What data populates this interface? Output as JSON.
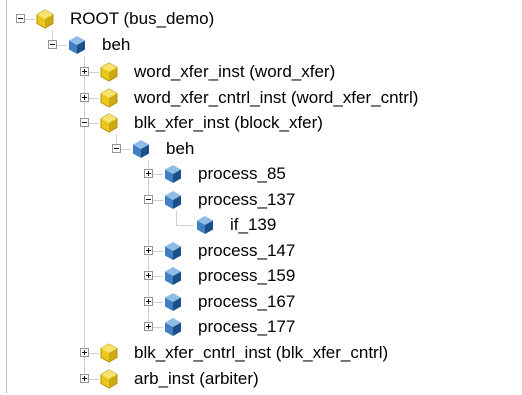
{
  "tree": {
    "nodes": [
      {
        "id": "root",
        "label": "ROOT (bus_demo)",
        "icon": "yellow-hexagon-icon",
        "state": "expanded"
      },
      {
        "id": "root-beh",
        "label": "beh",
        "icon": "blue-cube-icon",
        "state": "expanded"
      },
      {
        "id": "word-xfer-inst",
        "label": "word_xfer_inst (word_xfer)",
        "icon": "yellow-hexagon-icon",
        "state": "collapsed"
      },
      {
        "id": "word-xfer-cntrl-inst",
        "label": "word_xfer_cntrl_inst (word_xfer_cntrl)",
        "icon": "yellow-hexagon-icon",
        "state": "collapsed"
      },
      {
        "id": "blk-xfer-inst",
        "label": "blk_xfer_inst (block_xfer)",
        "icon": "yellow-hexagon-icon",
        "state": "expanded"
      },
      {
        "id": "blk-xfer-beh",
        "label": "beh",
        "icon": "blue-cube-icon",
        "state": "expanded"
      },
      {
        "id": "process-85",
        "label": "process_85",
        "icon": "blue-cube-icon",
        "state": "collapsed"
      },
      {
        "id": "process-137",
        "label": "process_137",
        "icon": "blue-cube-icon",
        "state": "expanded"
      },
      {
        "id": "if-139",
        "label": "if_139",
        "icon": "blue-cube-icon",
        "state": "leaf"
      },
      {
        "id": "process-147",
        "label": "process_147",
        "icon": "blue-cube-icon",
        "state": "collapsed"
      },
      {
        "id": "process-159",
        "label": "process_159",
        "icon": "blue-cube-icon",
        "state": "collapsed"
      },
      {
        "id": "process-167",
        "label": "process_167",
        "icon": "blue-cube-icon",
        "state": "collapsed"
      },
      {
        "id": "process-177",
        "label": "process_177",
        "icon": "blue-cube-icon",
        "state": "collapsed"
      },
      {
        "id": "blk-xfer-cntrl-inst",
        "label": "blk_xfer_cntrl_inst (blk_xfer_cntrl)",
        "icon": "yellow-hexagon-icon",
        "state": "collapsed"
      },
      {
        "id": "arb-inst",
        "label": "arb_inst (arbiter)",
        "icon": "yellow-hexagon-icon",
        "state": "collapsed"
      }
    ]
  },
  "colors": {
    "line": "#a0a0a0",
    "hex_light": "#f8e36a",
    "hex_mid": "#e9c81c",
    "hex_dark": "#b7920a",
    "cube_top": "#8fbde6",
    "cube_left": "#3f7fc2",
    "cube_right": "#1b4f8a"
  }
}
